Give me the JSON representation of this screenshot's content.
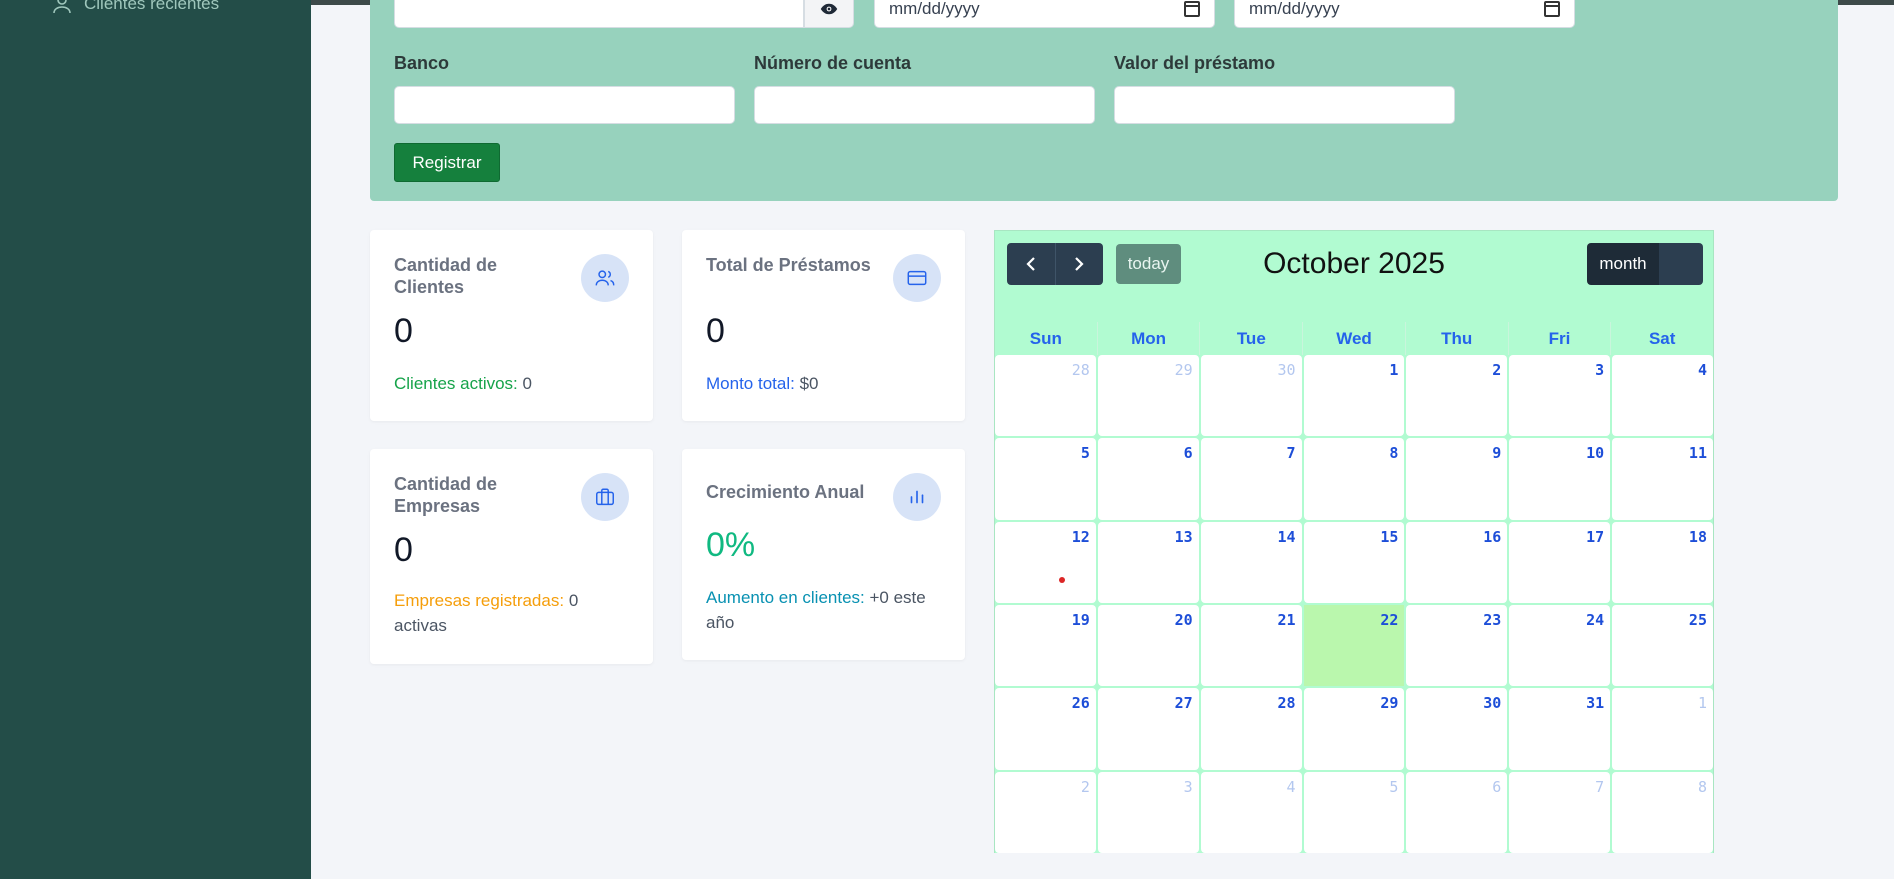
{
  "sidebar": {
    "recent_clients_label": "Clientes recientes"
  },
  "form": {
    "date_placeholder_1": "mm/dd/yyyy",
    "date_placeholder_2": "mm/dd/yyyy",
    "bank_label": "Banco",
    "bank_value": "",
    "account_label": "Número de cuenta",
    "account_value": "",
    "loan_label": "Valor del préstamo",
    "loan_value": "",
    "submit_label": "Registrar"
  },
  "cards": {
    "clients": {
      "title": "Cantidad de Clientes",
      "value": "0",
      "foot_label": "Clientes activos:",
      "foot_value": "0",
      "icon": "users-icon",
      "accent": "#16a34a"
    },
    "loans": {
      "title": "Total de Préstamos",
      "value": "0",
      "foot_label": "Monto total:",
      "foot_value": "$0",
      "icon": "credit-card-icon",
      "accent": "#2563eb"
    },
    "companies": {
      "title": "Cantidad de Empresas",
      "value": "0",
      "foot_label": "Empresas registradas:",
      "foot_value": "0 activas",
      "icon": "briefcase-icon",
      "accent": "#f59e0b"
    },
    "growth": {
      "title": "Crecimiento Anual",
      "value": "0%",
      "foot_label": "Aumento en clientes:",
      "foot_value": "+0 este año",
      "icon": "bar-chart-icon",
      "accent": "#0891b2",
      "value_color": "#10b981"
    }
  },
  "calendar": {
    "title": "October 2025",
    "prev_label": "‹",
    "next_label": "›",
    "today_label": "today",
    "view_label": "month",
    "weekdays": [
      "Sun",
      "Mon",
      "Tue",
      "Wed",
      "Thu",
      "Fri",
      "Sat"
    ],
    "days": [
      {
        "n": "28",
        "other": true
      },
      {
        "n": "29",
        "other": true
      },
      {
        "n": "30",
        "other": true
      },
      {
        "n": "1"
      },
      {
        "n": "2"
      },
      {
        "n": "3"
      },
      {
        "n": "4"
      },
      {
        "n": "5"
      },
      {
        "n": "6"
      },
      {
        "n": "7"
      },
      {
        "n": "8"
      },
      {
        "n": "9"
      },
      {
        "n": "10"
      },
      {
        "n": "11"
      },
      {
        "n": "12",
        "event": true
      },
      {
        "n": "13"
      },
      {
        "n": "14"
      },
      {
        "n": "15"
      },
      {
        "n": "16"
      },
      {
        "n": "17"
      },
      {
        "n": "18"
      },
      {
        "n": "19"
      },
      {
        "n": "20"
      },
      {
        "n": "21"
      },
      {
        "n": "22",
        "today": true
      },
      {
        "n": "23"
      },
      {
        "n": "24"
      },
      {
        "n": "25"
      },
      {
        "n": "26"
      },
      {
        "n": "27"
      },
      {
        "n": "28"
      },
      {
        "n": "29"
      },
      {
        "n": "30"
      },
      {
        "n": "31"
      },
      {
        "n": "1",
        "other": true
      },
      {
        "n": "2",
        "other": true
      },
      {
        "n": "3",
        "other": true
      },
      {
        "n": "4",
        "other": true
      },
      {
        "n": "5",
        "other": true
      },
      {
        "n": "6",
        "other": true
      },
      {
        "n": "7",
        "other": true
      },
      {
        "n": "8",
        "other": true
      }
    ]
  }
}
